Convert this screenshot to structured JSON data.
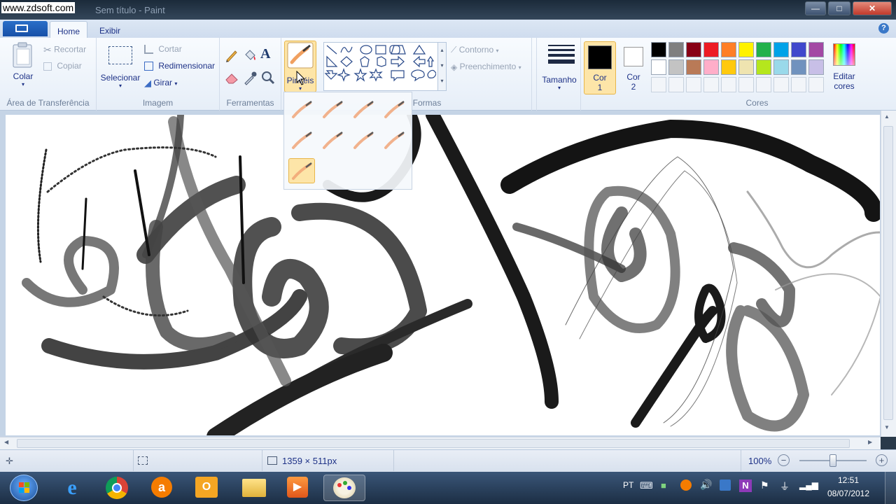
{
  "window": {
    "watermark": "www.zdsoft.com",
    "title": "Sem título - Paint",
    "minimize_label": "—",
    "maximize_label": "□",
    "close_label": "✕"
  },
  "tabs": [
    {
      "label": "Home"
    },
    {
      "label": "Exibir"
    }
  ],
  "help_label": "?",
  "ribbon": {
    "clipboard": {
      "paste": "Colar",
      "cut": "Recortar",
      "copy": "Copiar",
      "group_label": "Área de Transferência"
    },
    "image": {
      "select": "Selecionar",
      "crop": "Cortar",
      "resize": "Redimensionar",
      "rotate": "Girar",
      "group_label": "Imagem"
    },
    "tools": {
      "group_label": "Ferramentas",
      "items": [
        "pencil-icon",
        "fill-icon",
        "text-icon",
        "eraser-icon",
        "color-picker-icon",
        "magnifier-icon"
      ]
    },
    "brushes": {
      "label": "Pincéis"
    },
    "shapes": {
      "outline": "Contorno",
      "fill": "Preenchimento",
      "group_label": "Formas"
    },
    "size": {
      "label": "Tamanho"
    },
    "color1": {
      "label": "Cor",
      "num": "1",
      "value": "#000000"
    },
    "color2": {
      "label": "Cor",
      "num": "2",
      "value": "#ffffff"
    },
    "colors": {
      "group_label": "Cores",
      "edit_label": "Editar",
      "edit_label2": "cores",
      "row1": [
        "#000000",
        "#7f7f7f",
        "#880015",
        "#ed1c24",
        "#ff7f27",
        "#fff200",
        "#22b14c",
        "#00a2e8",
        "#3f48cc",
        "#a349a4"
      ],
      "row2": [
        "#ffffff",
        "#c3c3c3",
        "#b97a57",
        "#ffaec9",
        "#ffc90e",
        "#efe4b0",
        "#b5e61d",
        "#99d9ea",
        "#7092be",
        "#c8bfe7"
      ],
      "row3": [
        "",
        "",
        "",
        "",
        "",
        "",
        "",
        "",
        "",
        ""
      ]
    }
  },
  "status": {
    "dimensions": "1359 × 511px",
    "zoom": "100%",
    "zoom_out": "−",
    "zoom_in": "+",
    "zoom_level": 1.0
  },
  "taskbar": {
    "lang": "PT",
    "time": "12:51",
    "date": "08/07/2012",
    "items": [
      "start-orb-icon",
      "internet-explorer-icon",
      "chrome-icon",
      "avast-icon",
      "outlook-icon",
      "explorer-folder-icon",
      "media-player-icon",
      "paint-icon"
    ]
  }
}
